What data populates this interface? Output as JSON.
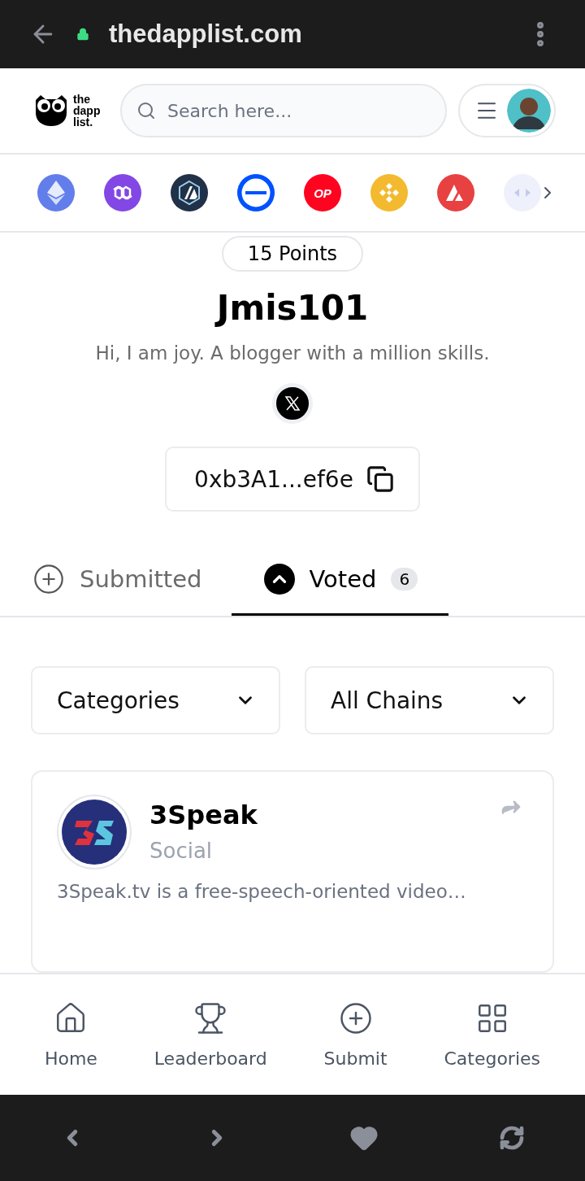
{
  "browser": {
    "url": "thedapplist.com"
  },
  "header": {
    "logo_text": [
      "the",
      "dapp",
      "list."
    ],
    "search": {
      "placeholder": "Search here..."
    }
  },
  "chains": [
    {
      "kind": "eth",
      "color": "#627eea"
    },
    {
      "kind": "polygon",
      "color": "#8247e5"
    },
    {
      "kind": "arbitrum",
      "color": "#213147"
    },
    {
      "kind": "base",
      "color": "#0052ff"
    },
    {
      "kind": "op",
      "color": "#ff0420",
      "label": "OP"
    },
    {
      "kind": "bnb",
      "color": "#f3ba2f"
    },
    {
      "kind": "avax",
      "color": "#e84142"
    },
    {
      "kind": "faded",
      "color": "#eef0fb"
    }
  ],
  "profile": {
    "points": "15 Points",
    "username": "Jmis101",
    "bio": "Hi, I am joy. A blogger with a million skills.",
    "wallet": "0xb3A1...ef6e"
  },
  "tabs": [
    {
      "label": "Submitted",
      "kind": "plus",
      "selected": false
    },
    {
      "label": "Voted",
      "kind": "vote",
      "selected": true,
      "count": "6"
    }
  ],
  "filters": [
    "Categories",
    "All Chains"
  ],
  "apps": [
    {
      "name": "3Speak",
      "category": "Social",
      "description": "3Speak.tv is a free-speech-oriented video…"
    }
  ],
  "bottom_nav": [
    {
      "label": "Home",
      "kind": "home"
    },
    {
      "label": "Leaderboard",
      "kind": "trophy"
    },
    {
      "label": "Submit",
      "kind": "submit"
    },
    {
      "label": "Categories",
      "kind": "grid"
    }
  ]
}
